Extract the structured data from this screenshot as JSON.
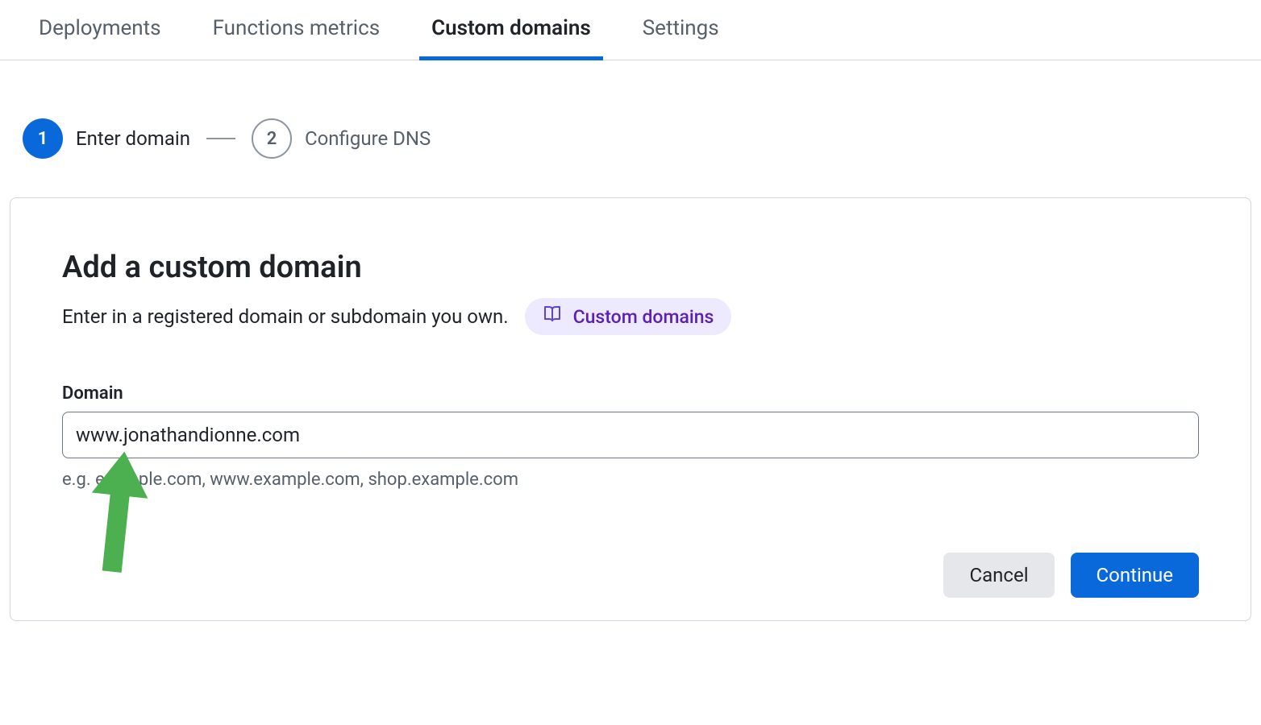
{
  "tabs": [
    {
      "label": "Deployments",
      "active": false
    },
    {
      "label": "Functions metrics",
      "active": false
    },
    {
      "label": "Custom domains",
      "active": true
    },
    {
      "label": "Settings",
      "active": false
    }
  ],
  "stepper": {
    "step1": {
      "num": "1",
      "label": "Enter domain"
    },
    "step2": {
      "num": "2",
      "label": "Configure DNS"
    }
  },
  "card": {
    "title": "Add a custom domain",
    "subtitle": "Enter in a registered domain or subdomain you own.",
    "doc_link_label": "Custom domains",
    "domain_label": "Domain",
    "domain_value": "www.jonathandionne.com",
    "domain_help": "e.g. example.com, www.example.com, shop.example.com",
    "cancel_label": "Cancel",
    "continue_label": "Continue"
  },
  "colors": {
    "accent_blue": "#0969da",
    "badge_purple_bg": "#ede9fe",
    "badge_purple_fg": "#5b21b6",
    "annotation_green": "#4CAF50"
  }
}
